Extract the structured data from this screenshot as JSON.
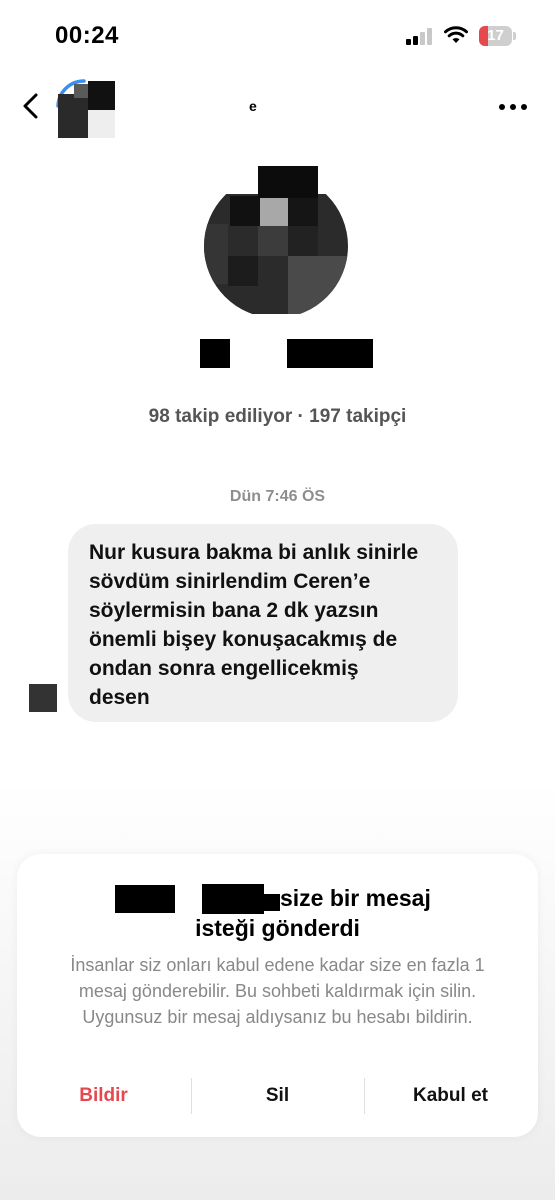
{
  "status_bar": {
    "time": "00:24",
    "battery_level": "17",
    "signal_bars_active": 2,
    "signal_bars_total": 4,
    "icons": [
      "signal-icon",
      "wifi-icon",
      "battery-icon"
    ]
  },
  "header": {
    "name": "e",
    "icons": [
      "back-chevron-icon",
      "more-options-icon"
    ]
  },
  "profile": {
    "stats": "98 takip ediliyor · 197 takipçi"
  },
  "conversation": {
    "timestamp": "Dün 7:46 ÖS",
    "message": "Nur kusura bakma bi anlık sinirle\nsövdüm sinirlendim Ceren’e\nsöylermisin bana 2 dk yazsın\nönemli bişey konuşacakmış de\nondan sonra engellicekmiş\ndesen"
  },
  "request_sheet": {
    "title_line1": "size bir mesaj",
    "title_line2": "isteği gönderdi",
    "description": "İnsanlar siz onları kabul edene kadar size en fazla 1 mesaj gönderebilir. Bu sohbeti kaldırmak için silin. Uygunsuz bir mesaj aldıysanız bu hesabı bildirin.",
    "actions": {
      "report": "Bildir",
      "delete": "Sil",
      "accept": "Kabul et"
    }
  },
  "colors": {
    "danger": "#e5484d",
    "secondary_text": "#8e8e8e",
    "bubble_bg": "#efefef"
  }
}
